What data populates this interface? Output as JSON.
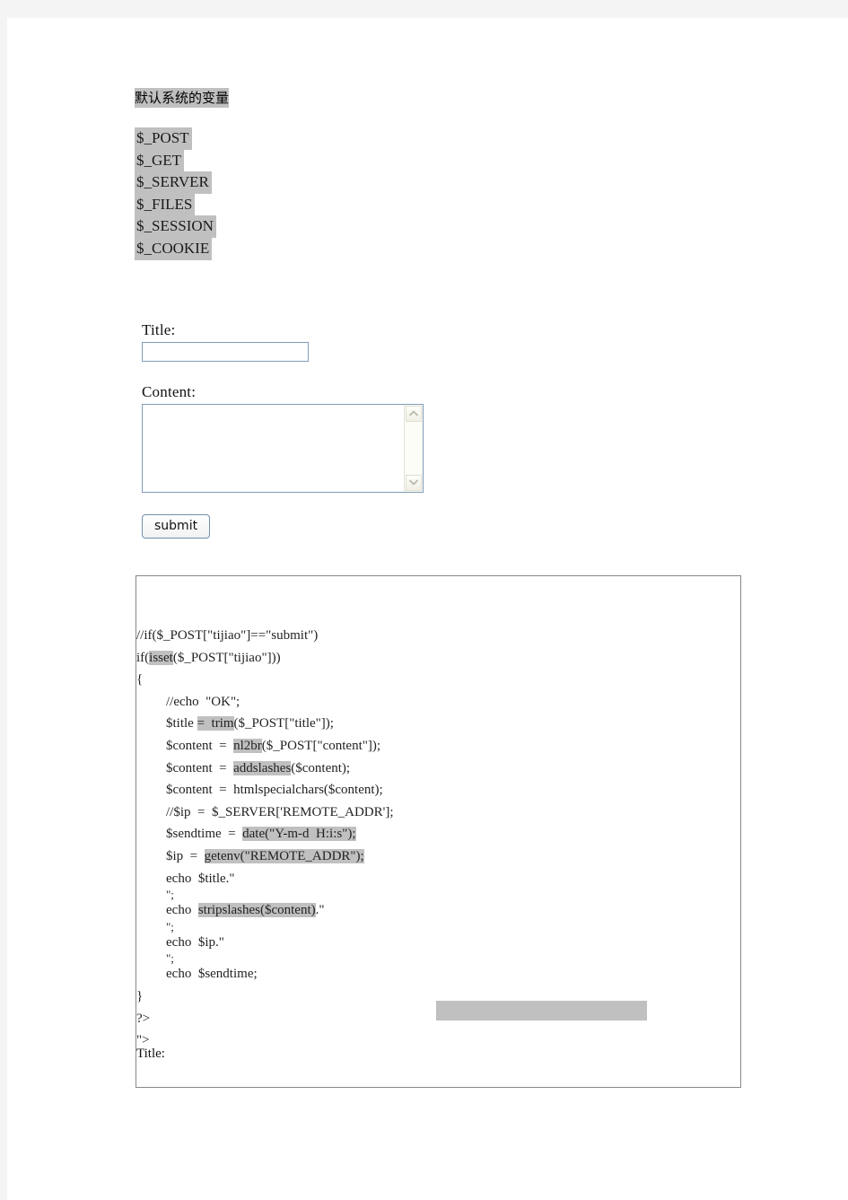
{
  "document": {
    "heading": "默认系统的变量",
    "superglobals": [
      "$_POST",
      "$_GET",
      "$_SERVER",
      "$_FILES",
      "$_SESSION",
      "$_COOKIE"
    ]
  },
  "form": {
    "title_label": "Title:",
    "title_value": "",
    "title_placeholder": "",
    "content_label": "Content:",
    "content_value": "",
    "content_placeholder": "",
    "submit_label": "submit",
    "scrollbar": {
      "up_icon": "chevron-up-icon",
      "down_icon": "chevron-down-icon"
    }
  },
  "code_block": {
    "lines": [
      {
        "indent": 0,
        "tight": false,
        "segments": [
          {
            "text": "//if($_POST[\"tijiao\"]==\"submit\")",
            "hl": false
          }
        ]
      },
      {
        "indent": 0,
        "tight": false,
        "segments": [
          {
            "text": "if(",
            "hl": false
          },
          {
            "text": "isset",
            "hl": true
          },
          {
            "text": "($_POST[\"tijiao\"]))",
            "hl": false
          }
        ]
      },
      {
        "indent": 0,
        "tight": false,
        "segments": [
          {
            "text": "{",
            "hl": false
          }
        ]
      },
      {
        "indent": 1,
        "tight": false,
        "segments": [
          {
            "text": "//echo  \"OK\";",
            "hl": false
          }
        ]
      },
      {
        "indent": 1,
        "tight": false,
        "segments": [
          {
            "text": "$title ",
            "hl": false
          },
          {
            "text": "=  trim",
            "hl": true
          },
          {
            "text": "($_POST[\"title\"]);",
            "hl": false
          }
        ]
      },
      {
        "indent": 1,
        "tight": false,
        "segments": [
          {
            "text": "$content  =  ",
            "hl": false
          },
          {
            "text": "nl2br",
            "hl": true
          },
          {
            "text": "($_POST[\"content\"]);",
            "hl": false
          }
        ]
      },
      {
        "indent": 1,
        "tight": false,
        "segments": [
          {
            "text": "$content  =  ",
            "hl": false
          },
          {
            "text": "addslashes",
            "hl": true
          },
          {
            "text": "($content);",
            "hl": false
          }
        ]
      },
      {
        "indent": 1,
        "tight": false,
        "segments": [
          {
            "text": "$content  =  htmlspecialchars($content);",
            "hl": false
          }
        ]
      },
      {
        "indent": 1,
        "tight": false,
        "segments": [
          {
            "text": "//$ip  =  $_SERVER['REMOTE_ADDR'];",
            "hl": false
          }
        ]
      },
      {
        "indent": 1,
        "tight": false,
        "segments": [
          {
            "text": "$sendtime  =  ",
            "hl": false
          },
          {
            "text": "date(\"Y-m-d  H:i:s\");",
            "hl": true
          }
        ]
      },
      {
        "indent": 1,
        "tight": false,
        "segments": [
          {
            "text": "$ip  =  ",
            "hl": false
          },
          {
            "text": "getenv(\"REMOTE_ADDR\");",
            "hl": true
          }
        ]
      },
      {
        "indent": 1,
        "tight": false,
        "segments": [
          {
            "text": "echo  $title.\"",
            "hl": false
          }
        ]
      },
      {
        "indent": 1,
        "tight": true,
        "segments": [
          {
            "text": "\";",
            "hl": false
          }
        ]
      },
      {
        "indent": 1,
        "tight": false,
        "segments": [
          {
            "text": "echo  ",
            "hl": false
          },
          {
            "text": "stripslashes($content)",
            "hl": true
          },
          {
            "text": ".\"",
            "hl": false
          }
        ]
      },
      {
        "indent": 1,
        "tight": true,
        "segments": [
          {
            "text": "\";",
            "hl": false
          }
        ]
      },
      {
        "indent": 1,
        "tight": false,
        "segments": [
          {
            "text": "echo  $ip.\"",
            "hl": false
          }
        ]
      },
      {
        "indent": 1,
        "tight": true,
        "segments": [
          {
            "text": "\";",
            "hl": false
          }
        ]
      },
      {
        "indent": 1,
        "tight": false,
        "segments": [
          {
            "text": "echo  $sendtime;",
            "hl": false
          }
        ]
      },
      {
        "indent": 0,
        "tight": false,
        "segments": [
          {
            "text": "}",
            "hl": false
          }
        ]
      },
      {
        "indent": 0,
        "tight": false,
        "segments": [
          {
            "text": "?>",
            "hl": false
          }
        ]
      },
      {
        "indent": 0,
        "tight": false,
        "segments": [
          {
            "text": "\">",
            "hl": false
          }
        ]
      }
    ],
    "trailing_label": "Title:",
    "empty_highlight_bar": ""
  },
  "colors": {
    "page_background": "#f4f4f4",
    "sheet": "#ffffff",
    "highlight": "#c0c0c0",
    "input_border": "#7f9db9",
    "code_box_border": "#888888",
    "text": "#1a1a1a"
  }
}
